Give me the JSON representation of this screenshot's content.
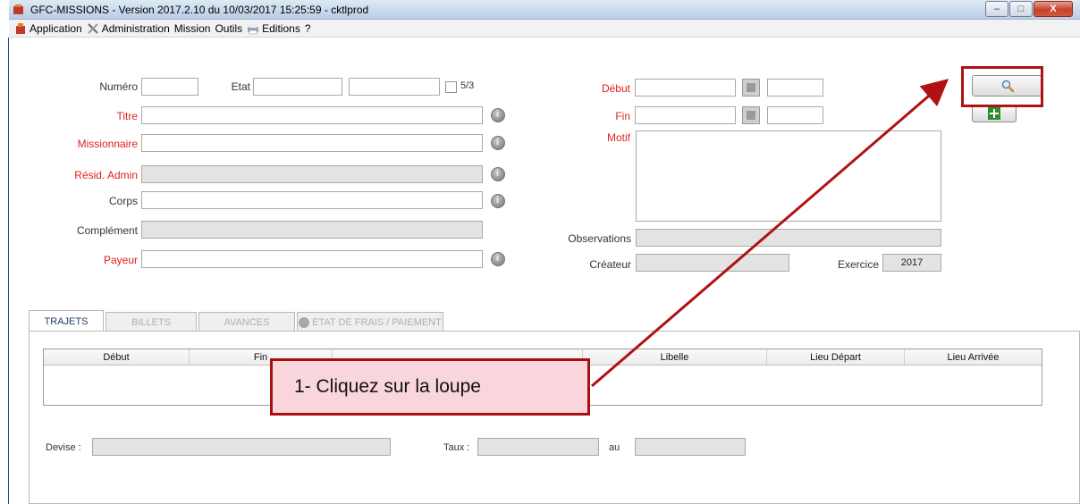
{
  "window": {
    "title": "GFC-MISSIONS - Version 2017.2.10 du 10/03/2017 15:25:59 - cktlprod",
    "minimize": "–",
    "maximize": "□",
    "close": "X"
  },
  "menu": {
    "items": [
      {
        "label": "Application",
        "icon": "app-icon"
      },
      {
        "label": "Administration",
        "icon": "tools-icon"
      },
      {
        "label": "Mission",
        "icon": ""
      },
      {
        "label": "Outils",
        "icon": ""
      },
      {
        "label": "Editions",
        "icon": "printer-icon"
      },
      {
        "label": "?",
        "icon": ""
      }
    ]
  },
  "form": {
    "numero_label": "Numéro",
    "etat_label": "Etat",
    "checkbox_label": "5/3",
    "titre_label": "Titre",
    "missionnaire_label": "Missionnaire",
    "resid_label": "Résid. Admin",
    "corps_label": "Corps",
    "complement_label": "Complément",
    "payeur_label": "Payeur",
    "debut_label": "Début",
    "fin_label": "Fin",
    "motif_label": "Motif",
    "observations_label": "Observations",
    "createur_label": "Créateur",
    "exercice_label": "Exercice",
    "exercice_value": "2017"
  },
  "tabs": [
    {
      "label": "TRAJETS",
      "active": true
    },
    {
      "label": "BILLETS",
      "active": false
    },
    {
      "label": "AVANCES",
      "active": false
    },
    {
      "label": "ETAT DE FRAIS / PAIEMENT",
      "active": false
    }
  ],
  "grid": {
    "columns": [
      "Début",
      "Fin",
      "",
      "Libelle",
      "Lieu Départ",
      "Lieu Arrivée"
    ]
  },
  "bottom": {
    "devise_label": "Devise :",
    "taux_label": "Taux :",
    "au_label": "au"
  },
  "annotation": {
    "callout_text": "1-   Cliquez sur la loupe",
    "color": "#b01212"
  }
}
